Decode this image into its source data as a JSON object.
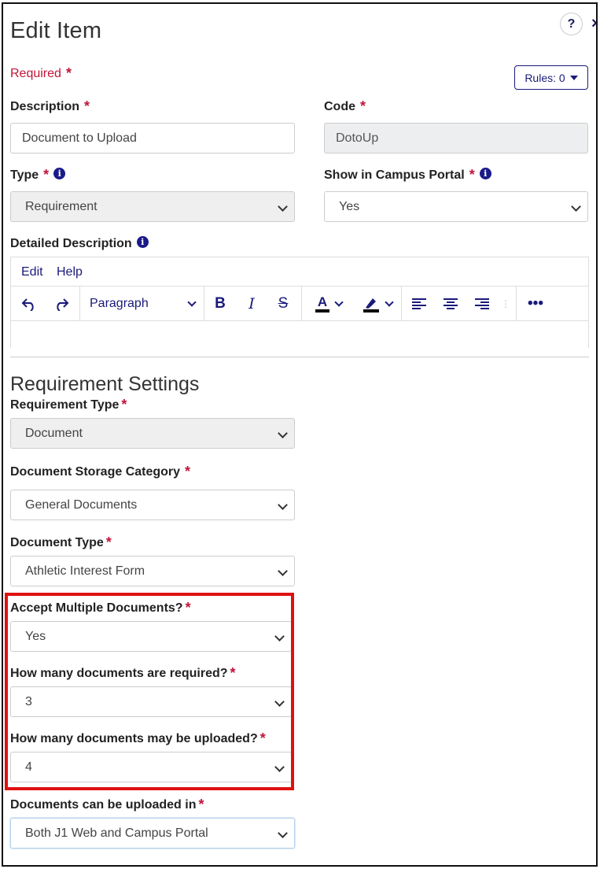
{
  "header": {
    "title": "Edit Item",
    "help_label": "?",
    "close_label": "×"
  },
  "required_note": "Required",
  "required_star": "*",
  "rules_button": "Rules: 0",
  "fields": {
    "description": {
      "label": "Description",
      "value": "Document to Upload"
    },
    "code": {
      "label": "Code",
      "value": "DotoUp"
    },
    "type": {
      "label": "Type",
      "value": "Requirement"
    },
    "show_in_portal": {
      "label": "Show in Campus Portal",
      "value": "Yes"
    },
    "detailed_description": {
      "label": "Detailed Description"
    }
  },
  "editor": {
    "menu": [
      "Edit",
      "Help"
    ],
    "block_format": "Paragraph",
    "icons": [
      "undo-icon",
      "redo-icon",
      "bold-icon",
      "italic-icon",
      "strikethrough-icon",
      "text-color-icon",
      "highlight-color-icon",
      "align-left-icon",
      "align-center-icon",
      "align-right-icon",
      "more-icon"
    ]
  },
  "requirement_settings": {
    "title": "Requirement Settings",
    "requirement_type": {
      "label": "Requirement Type",
      "value": "Document"
    },
    "storage_category": {
      "label": "Document Storage Category",
      "value": "General Documents"
    },
    "document_type": {
      "label": "Document Type",
      "value": "Athletic Interest Form"
    },
    "accept_multiple": {
      "label": "Accept Multiple Documents?",
      "value": "Yes"
    },
    "docs_required": {
      "label": "How many documents are required?",
      "value": "3"
    },
    "docs_max": {
      "label": "How many documents may be uploaded?",
      "value": "4"
    },
    "upload_location": {
      "label": "Documents can be uploaded in",
      "value": "Both J1 Web and Campus Portal"
    }
  },
  "colors": {
    "accent": "#1a1a7a",
    "required": "#c0163a",
    "highlight_box": "#e01010"
  }
}
